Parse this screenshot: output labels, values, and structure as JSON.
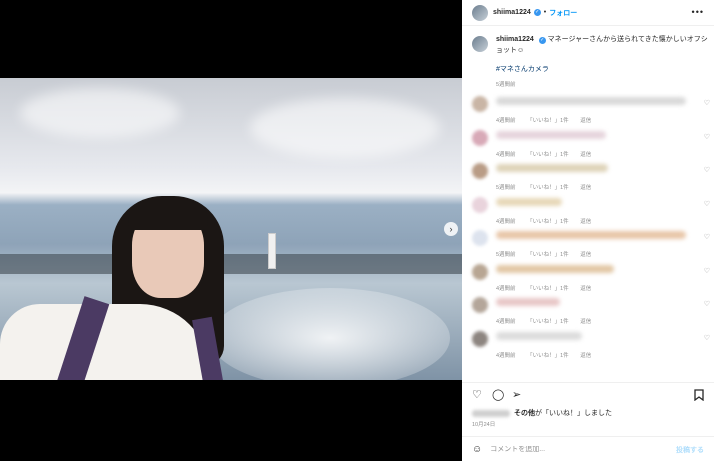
{
  "header": {
    "username": "shiima1224",
    "separator": "•",
    "follow_label": "フォロー",
    "more_icon": "more-horizontal-icon"
  },
  "caption": {
    "username": "shiima1224",
    "text": "マネージャーさんから送られてきた懐かしいオフショット☺︎",
    "hashtag": "#マネさんカメラ",
    "time": "5週間前"
  },
  "comments": [
    {
      "time": "4週間前",
      "likes": "「いいね！」1件",
      "reply": "返信",
      "blur_color": "#d9d9d9",
      "blur_width": 190,
      "avatar_color": "#c9b5a5"
    },
    {
      "time": "4週間前",
      "likes": "「いいね！」1件",
      "reply": "返信",
      "blur_color": "#e6d4dc",
      "blur_width": 110,
      "avatar_color": "#d8a9b7"
    },
    {
      "time": "5週間前",
      "likes": "「いいね！」1件",
      "reply": "返信",
      "blur_color": "#ded3b8",
      "blur_width": 112,
      "avatar_color": "#b99c86"
    },
    {
      "time": "4週間前",
      "likes": "「いいね！」1件",
      "reply": "返信",
      "blur_color": "#e7d8b8",
      "blur_width": 66,
      "avatar_color": "#e9d3dc"
    },
    {
      "time": "5週間前",
      "likes": "「いいね！」1件",
      "reply": "返信",
      "blur_color": "#e8c6a8",
      "blur_width": 190,
      "avatar_color": "#dde3ee"
    },
    {
      "time": "4週間前",
      "likes": "「いいね！」1件",
      "reply": "返信",
      "blur_color": "#e2c7a5",
      "blur_width": 118,
      "avatar_color": "#b8a693"
    },
    {
      "time": "4週間前",
      "likes": "「いいね！」1件",
      "reply": "返信",
      "blur_color": "#e8c7c7",
      "blur_width": 64,
      "avatar_color": "#b4a69a"
    },
    {
      "time": "4週間前",
      "likes": "「いいね！」1件",
      "reply": "返信",
      "blur_color": "#dcdcdc",
      "blur_width": 86,
      "avatar_color": "#8d8580"
    }
  ],
  "actions": {
    "like_icon": "heart-icon",
    "comment_icon": "comment-icon",
    "share_icon": "send-icon",
    "save_icon": "bookmark-icon"
  },
  "likes": {
    "bold": "その他",
    "text": "が「いいね！」しました"
  },
  "date": "10月24日",
  "add_comment": {
    "placeholder": "コメントを追加...",
    "post_label": "投稿する",
    "emoji_icon": "emoji-icon"
  },
  "media": {
    "next_icon": "chevron-right-icon"
  }
}
